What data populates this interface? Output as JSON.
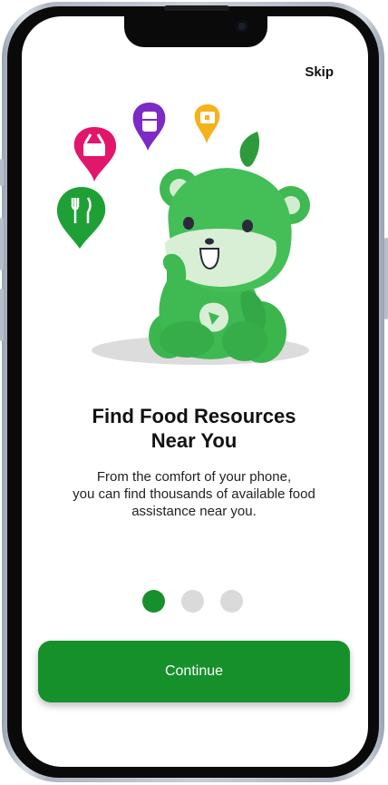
{
  "header": {
    "skip_label": "Skip"
  },
  "onboarding": {
    "title_line1": "Find Food Resources",
    "title_line2": "Near You",
    "description_line1": "From the comfort of your phone,",
    "description_line2": "you can find thousands of available food",
    "description_line3": "assistance near you.",
    "current_step": 1,
    "total_steps": 3,
    "continue_label": "Continue"
  },
  "illustration": {
    "icons": [
      "bear-mascot-icon",
      "grocery-basket-pin-icon",
      "fridge-pin-icon",
      "calendar-pin-icon",
      "utensils-pin-icon",
      "leaf-icon"
    ]
  },
  "colors": {
    "primary": "#16902b",
    "inactive_dot": "#dadada",
    "text": "#111111"
  }
}
